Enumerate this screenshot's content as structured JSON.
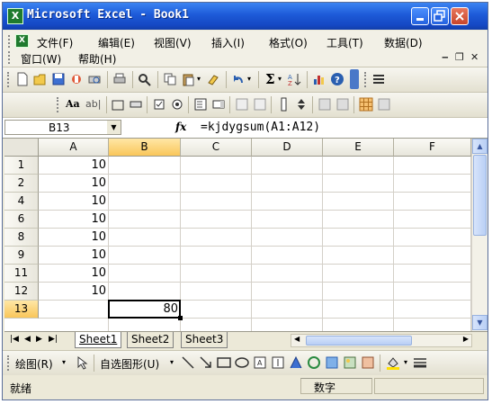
{
  "window": {
    "title": "Microsoft Excel - Book1",
    "app_icon": "X"
  },
  "menu": {
    "items": [
      "文件(F)",
      "编辑(E)",
      "视图(V)",
      "插入(I)",
      "格式(O)",
      "工具(T)",
      "数据(D)"
    ],
    "items_row2": [
      "窗口(W)",
      "帮助(H)"
    ]
  },
  "formula_bar": {
    "name_box": "B13",
    "fx_label": "fx",
    "formula": "=kjdygsum(A1:A12)"
  },
  "grid": {
    "columns": [
      "A",
      "B",
      "C",
      "D",
      "E",
      "F"
    ],
    "active_column": "B",
    "rows": [
      {
        "header": "1",
        "a": "10",
        "b": ""
      },
      {
        "header": "2",
        "a": "10",
        "b": ""
      },
      {
        "header": "4",
        "a": "10",
        "b": ""
      },
      {
        "header": "6",
        "a": "10",
        "b": ""
      },
      {
        "header": "8",
        "a": "10",
        "b": ""
      },
      {
        "header": "9",
        "a": "10",
        "b": ""
      },
      {
        "header": "11",
        "a": "10",
        "b": ""
      },
      {
        "header": "12",
        "a": "10",
        "b": ""
      },
      {
        "header": "13",
        "a": "",
        "b": "80"
      }
    ],
    "active_row": "13"
  },
  "sheets": {
    "tabs": [
      "Sheet1",
      "Sheet2",
      "Sheet3"
    ],
    "active": "Sheet1"
  },
  "draw_toolbar": {
    "draw_label": "绘图(R)",
    "autoshape_label": "自选图形(U)"
  },
  "status": {
    "left": "就绪",
    "mode": "数字"
  },
  "colors": {
    "titlebar": "#1d5ad8",
    "active_header": "#f9c65a"
  }
}
